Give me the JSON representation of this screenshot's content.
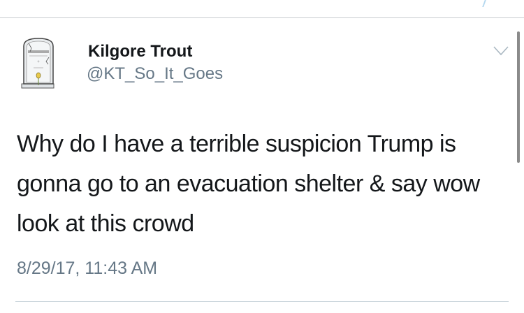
{
  "tweet": {
    "author_name": "Kilgore Trout",
    "author_handle": "@KT_So_It_Goes",
    "text": "Why do I have a terrible suspicion Trump is gonna go to an evacuation shelter & say wow look at this crowd",
    "timestamp": "8/29/17, 11:43 AM",
    "avatar_icon": "tombstone-avatar",
    "menu_icon": "chevron-down-icon"
  }
}
